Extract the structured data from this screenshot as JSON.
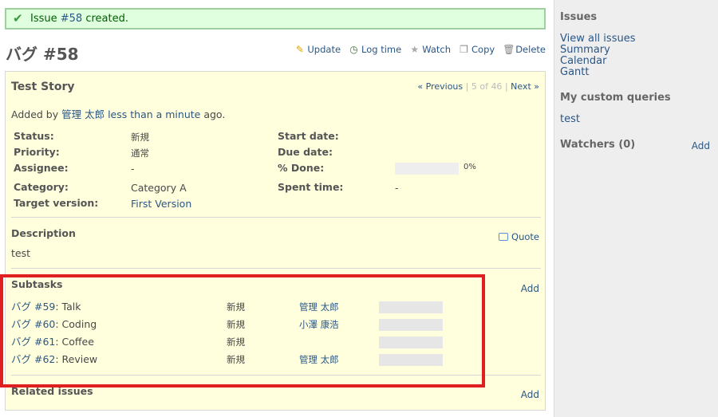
{
  "flash": {
    "message_prefix": "Issue ",
    "issue_link": "#58",
    "message_suffix": " created."
  },
  "page": {
    "title": "バグ #58"
  },
  "actions": {
    "update": "Update",
    "log_time": "Log time",
    "watch": "Watch",
    "copy": "Copy",
    "delete": "Delete"
  },
  "issue": {
    "subject": "Test Story",
    "nav": {
      "previous": "« Previous",
      "position": "5 of 46",
      "next": "Next »"
    },
    "author": {
      "prefix": "Added by ",
      "name": "管理 太郎",
      "time": "less than a minute",
      "suffix": " ago."
    },
    "attributes": {
      "status_label": "Status:",
      "status_value": "新規",
      "priority_label": "Priority:",
      "priority_value": "通常",
      "assignee_label": "Assignee:",
      "assignee_value": "-",
      "category_label": "Category:",
      "category_value": "Category A",
      "target_label": "Target version:",
      "target_value": "First Version",
      "start_label": "Start date:",
      "due_label": "Due date:",
      "done_label": "% Done:",
      "done_value": "0%",
      "done_percent": 0,
      "spent_label": "Spent time:",
      "spent_value": "-"
    },
    "description": {
      "heading": "Description",
      "quote": "Quote",
      "text": "test"
    },
    "subtasks": {
      "heading": "Subtasks",
      "add": "Add",
      "rows": [
        {
          "tracker": "バグ #59",
          "subject": ": Talk",
          "status": "新規",
          "assignee": "管理 太郎",
          "done_percent": 0
        },
        {
          "tracker": "バグ #60",
          "subject": ": Coding",
          "status": "新規",
          "assignee": "小澤 康浩",
          "done_percent": 0
        },
        {
          "tracker": "バグ #61",
          "subject": ": Coffee",
          "status": "新規",
          "assignee": "",
          "done_percent": 0
        },
        {
          "tracker": "バグ #62",
          "subject": ": Review",
          "status": "新規",
          "assignee": "管理 太郎",
          "done_percent": 0
        }
      ]
    },
    "related": {
      "heading": "Related issues",
      "add": "Add"
    }
  },
  "sidebar": {
    "issues_heading": "Issues",
    "links": [
      "View all issues",
      "Summary",
      "Calendar",
      "Gantt"
    ],
    "custom_heading": "My custom queries",
    "custom_links": [
      "test"
    ],
    "watchers_heading": "Watchers (0)",
    "watchers_add": "Add"
  },
  "colors": {
    "link": "#2A5685",
    "issue_bg": "#FFFFDD",
    "highlight": "#E02020",
    "flash_bg": "#DFFFDF"
  }
}
